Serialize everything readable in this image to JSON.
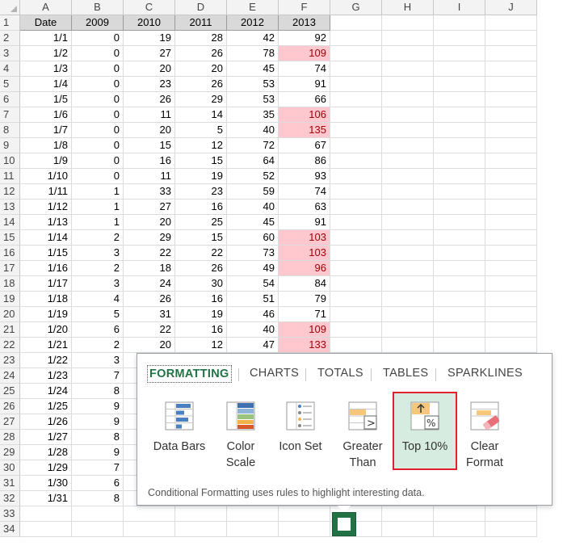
{
  "columns": [
    "A",
    "B",
    "C",
    "D",
    "E",
    "F",
    "G",
    "H",
    "I",
    "J"
  ],
  "header_row": [
    "Date",
    "2009",
    "2010",
    "2011",
    "2012",
    "2013"
  ],
  "rows": [
    {
      "date": "1/1",
      "v": [
        0,
        19,
        28,
        42,
        92
      ],
      "hl": false
    },
    {
      "date": "1/2",
      "v": [
        0,
        27,
        26,
        78,
        109
      ],
      "hl": true
    },
    {
      "date": "1/3",
      "v": [
        0,
        20,
        20,
        45,
        74
      ],
      "hl": false
    },
    {
      "date": "1/4",
      "v": [
        0,
        23,
        26,
        53,
        91
      ],
      "hl": false
    },
    {
      "date": "1/5",
      "v": [
        0,
        26,
        29,
        53,
        66
      ],
      "hl": false
    },
    {
      "date": "1/6",
      "v": [
        0,
        11,
        14,
        35,
        106
      ],
      "hl": true
    },
    {
      "date": "1/7",
      "v": [
        0,
        20,
        5,
        40,
        135
      ],
      "hl": true
    },
    {
      "date": "1/8",
      "v": [
        0,
        15,
        12,
        72,
        67
      ],
      "hl": false
    },
    {
      "date": "1/9",
      "v": [
        0,
        16,
        15,
        64,
        86
      ],
      "hl": false
    },
    {
      "date": "1/10",
      "v": [
        0,
        11,
        19,
        52,
        93
      ],
      "hl": false
    },
    {
      "date": "1/11",
      "v": [
        1,
        33,
        23,
        59,
        74
      ],
      "hl": false
    },
    {
      "date": "1/12",
      "v": [
        1,
        27,
        16,
        40,
        63
      ],
      "hl": false
    },
    {
      "date": "1/13",
      "v": [
        1,
        20,
        25,
        45,
        91
      ],
      "hl": false
    },
    {
      "date": "1/14",
      "v": [
        2,
        29,
        15,
        60,
        103
      ],
      "hl": true
    },
    {
      "date": "1/15",
      "v": [
        3,
        22,
        22,
        73,
        103
      ],
      "hl": true
    },
    {
      "date": "1/16",
      "v": [
        2,
        18,
        26,
        49,
        96
      ],
      "hl": true
    },
    {
      "date": "1/17",
      "v": [
        3,
        24,
        30,
        54,
        84
      ],
      "hl": false
    },
    {
      "date": "1/18",
      "v": [
        4,
        26,
        16,
        51,
        79
      ],
      "hl": false
    },
    {
      "date": "1/19",
      "v": [
        5,
        31,
        19,
        46,
        71
      ],
      "hl": false
    },
    {
      "date": "1/20",
      "v": [
        6,
        22,
        16,
        40,
        109
      ],
      "hl": true
    },
    {
      "date": "1/21",
      "v": [
        2,
        20,
        12,
        47,
        133
      ],
      "hl": true
    },
    {
      "date": "1/22",
      "v": [
        3,
        "",
        "",
        "",
        ""
      ],
      "hl": false
    },
    {
      "date": "1/23",
      "v": [
        7,
        "",
        "",
        "",
        ""
      ],
      "hl": false
    },
    {
      "date": "1/24",
      "v": [
        8,
        "",
        "",
        "",
        ""
      ],
      "hl": false
    },
    {
      "date": "1/25",
      "v": [
        9,
        "",
        "",
        "",
        ""
      ],
      "hl": false
    },
    {
      "date": "1/26",
      "v": [
        9,
        "",
        "",
        "",
        ""
      ],
      "hl": false
    },
    {
      "date": "1/27",
      "v": [
        8,
        "",
        "",
        "",
        ""
      ],
      "hl": false
    },
    {
      "date": "1/28",
      "v": [
        9,
        "",
        "",
        "",
        ""
      ],
      "hl": false
    },
    {
      "date": "1/29",
      "v": [
        7,
        "",
        "",
        "",
        ""
      ],
      "hl": false
    },
    {
      "date": "1/30",
      "v": [
        6,
        "",
        "",
        "",
        ""
      ],
      "hl": false
    },
    {
      "date": "1/31",
      "v": [
        8,
        "",
        "",
        "",
        ""
      ],
      "hl": false
    }
  ],
  "extra_row_numbers": [
    "33",
    "34"
  ],
  "quick_analysis": {
    "tabs": [
      "FORMATTING",
      "CHARTS",
      "TOTALS",
      "TABLES",
      "SPARKLINES"
    ],
    "tools": [
      {
        "line1": "Data Bars",
        "line2": "",
        "icon": "data-bars-icon"
      },
      {
        "line1": "Color",
        "line2": "Scale",
        "icon": "color-scale-icon"
      },
      {
        "line1": "Icon Set",
        "line2": "",
        "icon": "icon-set-icon"
      },
      {
        "line1": "Greater",
        "line2": "Than",
        "icon": "greater-than-icon"
      },
      {
        "line1": "Top 10%",
        "line2": "",
        "icon": "top-10-percent-icon"
      },
      {
        "line1": "Clear",
        "line2": "Format",
        "icon": "clear-format-icon"
      }
    ],
    "selected_tool": "Top 10%",
    "footer": "Conditional Formatting uses rules to highlight interesting data."
  },
  "colors": {
    "highlight_fill": "#ffc7ce",
    "highlight_text": "#9c0006",
    "accent": "#217346",
    "selection_border": "#e0202b"
  }
}
